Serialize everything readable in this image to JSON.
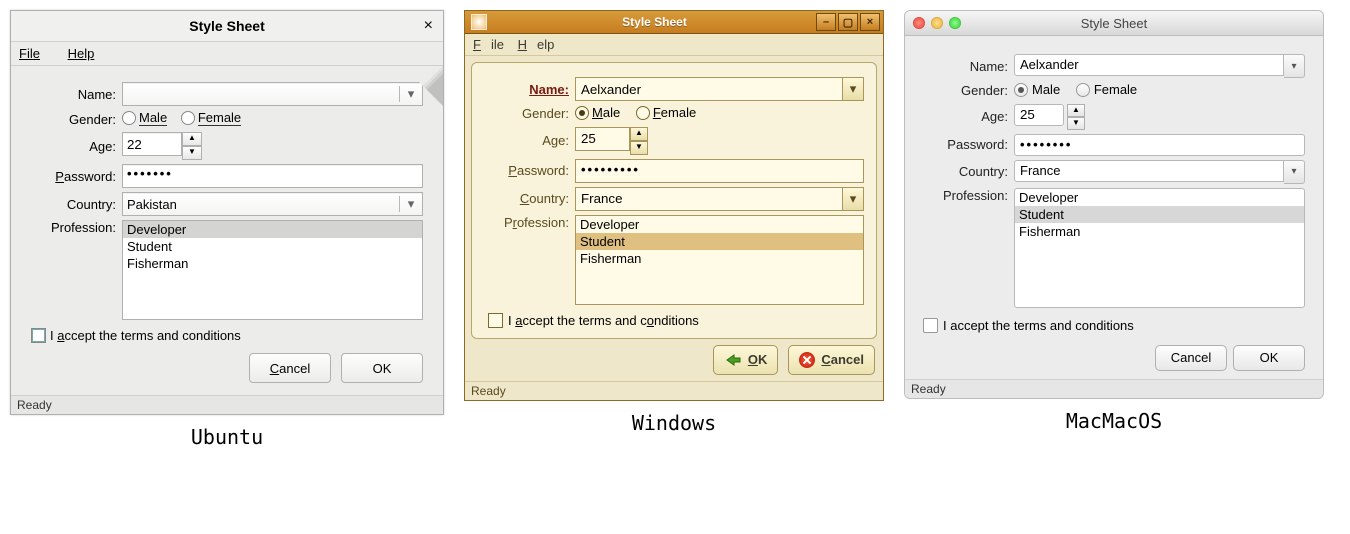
{
  "title": "Style Sheet",
  "menu": {
    "file": "File",
    "help": "Help"
  },
  "labels": {
    "name": "Name:",
    "gender": "Gender:",
    "age": "Age:",
    "password": "Password:",
    "country": "Country:",
    "profession": "Profession:",
    "male": "Male",
    "female": "Female",
    "terms": "I accept the terms and conditions",
    "cancel": "Cancel",
    "ok": "OK",
    "ready": "Ready"
  },
  "professions": [
    "Developer",
    "Student",
    "Fisherman"
  ],
  "ubuntu": {
    "name": "",
    "age": "22",
    "pwd": "•••••••",
    "country": "Pakistan",
    "gender": "none",
    "prof_sel": 0,
    "terms_checked": false,
    "caption": "Ubuntu"
  },
  "windows": {
    "name": "Aelxander",
    "age": "25",
    "pwd": "•••••••••",
    "country": "France",
    "gender": "male",
    "prof_sel": 1,
    "terms_checked": false,
    "caption": "Windows"
  },
  "mac": {
    "name": "Aelxander",
    "age": "25",
    "pwd": "••••••••",
    "country": "France",
    "gender": "male",
    "prof_sel": 1,
    "terms_checked": false,
    "caption": "MacMacOS"
  }
}
